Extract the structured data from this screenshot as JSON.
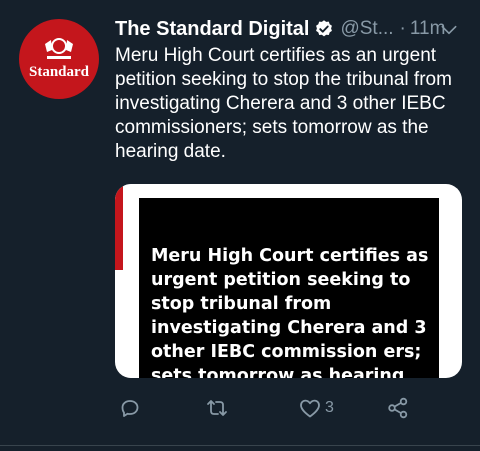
{
  "tweet": {
    "account_name": "The Standard Digital",
    "handle": "@St...",
    "separator": "·",
    "time": "11m",
    "avatar_text": "Standard",
    "text": "Meru High Court certifies as an urgent petition seeking to stop the tribunal from investigating Cherera and 3 other IEBC commissioners; sets tomorrow as the hearing date.",
    "media_headline": "Meru High Court certifies as urgent petition seeking to stop tribunal from investigating Cherera and 3 other IEBC commission ers; sets tomorrow as hearing",
    "like_count": "3"
  },
  "icons": {
    "verified": "verified-badge-icon",
    "menu": "chevron-down-icon",
    "reply": "reply-icon",
    "retweet": "retweet-icon",
    "like": "heart-icon",
    "share": "share-icon"
  },
  "colors": {
    "background": "#15202b",
    "secondary_text": "#8899a6",
    "brand_red": "#c4161c"
  }
}
